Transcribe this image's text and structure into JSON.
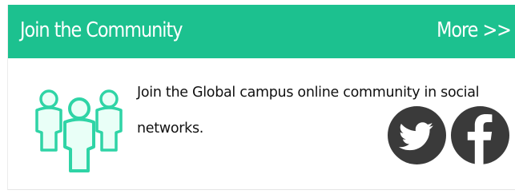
{
  "widget": {
    "title": "Join the Community",
    "more_label": "More >>",
    "description": "Join the Global campus online community in social networks."
  },
  "social": [
    {
      "name": "twitter",
      "icon": "twitter-bird-icon"
    },
    {
      "name": "facebook",
      "icon": "facebook-f-icon"
    }
  ],
  "colors": {
    "header_bg": "#1cc18f",
    "header_text": "#ffffff",
    "social_icon_bg": "#3a3a3a",
    "community_icon": "#2fd4a6"
  }
}
